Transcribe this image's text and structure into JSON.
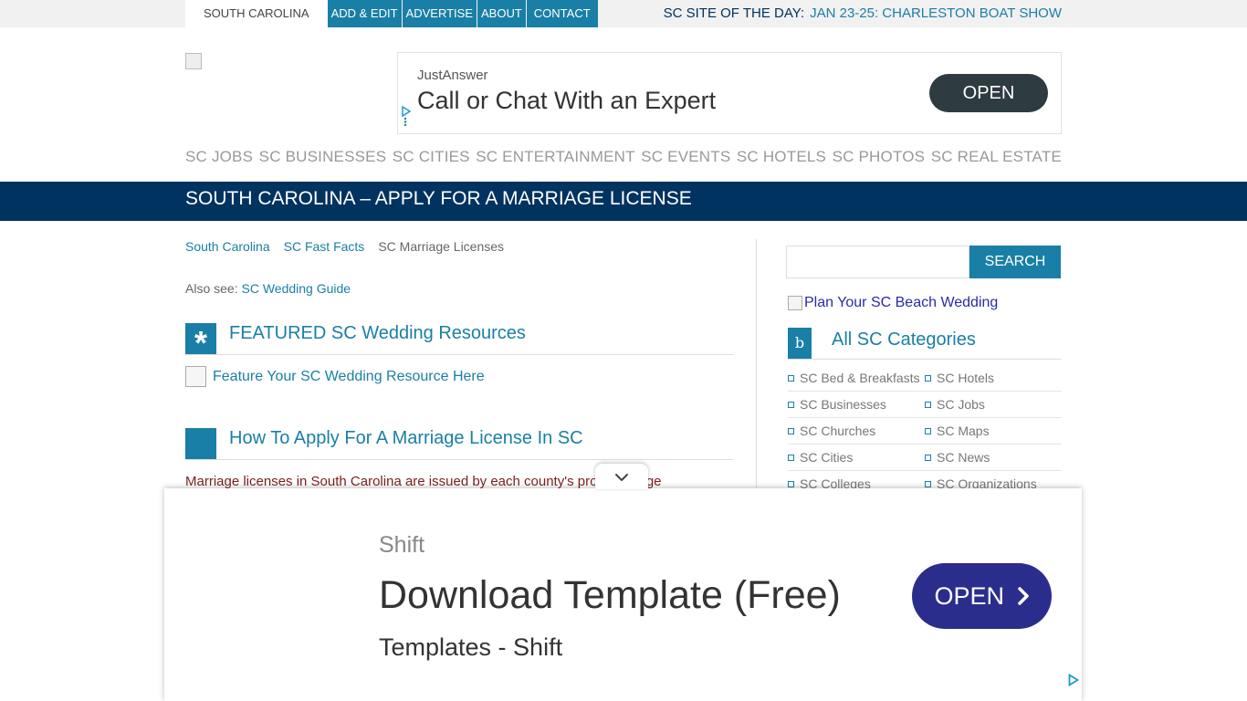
{
  "topbar": {
    "nav": [
      "SOUTH CAROLINA",
      "ADD & EDIT",
      "ADVERTISE",
      "ABOUT",
      "CONTACT"
    ],
    "site_day_label": "SC SITE OF THE DAY:",
    "site_day_link": "JAN 23-25: CHARLESTON BOAT SHOW"
  },
  "ad_top": {
    "brand": "JustAnswer",
    "headline": "Call or Chat With an Expert",
    "button": "OPEN"
  },
  "mainnav": [
    "SC JOBS",
    "SC BUSINESSES",
    "SC CITIES",
    "SC ENTERTAINMENT",
    "SC EVENTS",
    "SC HOTELS",
    "SC PHOTOS",
    "SC REAL ESTATE"
  ],
  "page_title": "SOUTH CAROLINA – APPLY FOR A MARRIAGE LICENSE",
  "breadcrumb": [
    "South Carolina",
    "SC Fast Facts",
    "SC Marriage Licenses"
  ],
  "also_see": {
    "label": "Also see:",
    "link": "SC Wedding Guide"
  },
  "featured": {
    "icon_glyph": "*",
    "title": "FEATURED SC Wedding Resources",
    "link": "Feature Your SC Wedding Resource Here"
  },
  "howto": {
    "icon_glyph": "",
    "title": "How To Apply For A Marriage License In SC",
    "paragraph": "Marriage licenses in South Carolina are issued by each county's probate judge"
  },
  "sidebar": {
    "search_icon_glyph": "",
    "search_button": "SEARCH",
    "beach_link": "Plan Your SC Beach Wedding",
    "categories_icon_glyph": "b",
    "categories_title": "All SC Categories",
    "categories": [
      [
        "SC Bed & Breakfasts",
        "SC Hotels"
      ],
      [
        "SC Businesses",
        "SC Jobs"
      ],
      [
        "SC Churches",
        "SC Maps"
      ],
      [
        "SC Cities",
        "SC News"
      ],
      [
        "SC Colleges",
        "SC Organizations"
      ]
    ]
  },
  "ad_bottom": {
    "brand": "Shift",
    "headline": "Download Template (Free)",
    "subline": "Templates - Shift",
    "button": "OPEN"
  },
  "colors": {
    "accent_blue": "#1a7fa6",
    "navy": "#003360",
    "ad_button_dark": "#2e3b40",
    "ad_button_indigo": "#2b2d8c"
  }
}
